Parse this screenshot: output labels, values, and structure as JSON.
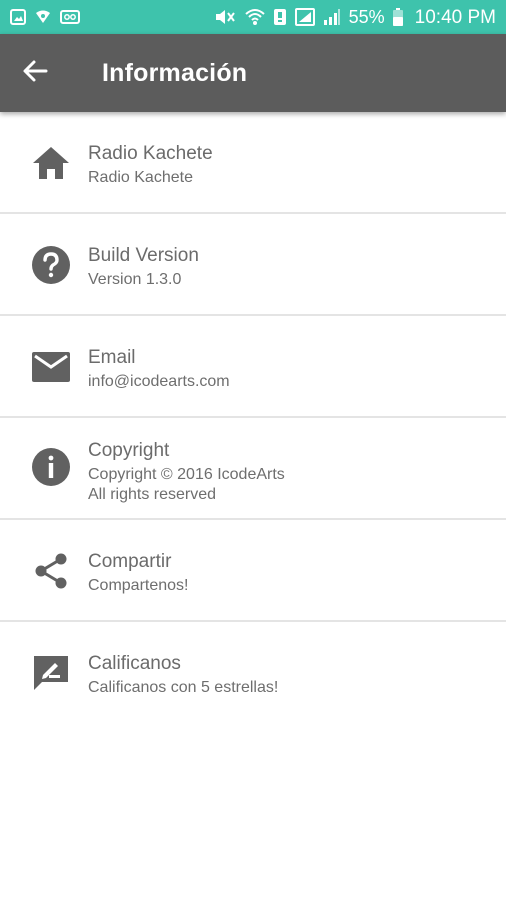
{
  "status_bar": {
    "battery": "55%",
    "time": "10:40 PM",
    "icons": [
      "gallery-icon",
      "hotspot-icon",
      "voicemail-icon",
      "mute-icon",
      "wifi-icon",
      "battery-saver-icon",
      "signal-icon",
      "battery-icon"
    ]
  },
  "app_bar": {
    "title": "Información",
    "background": "#5c5c5c",
    "accent": "#3ec3ac"
  },
  "items": [
    {
      "icon": "home-icon",
      "title": "Radio Kachete",
      "subtitle": "Radio Kachete"
    },
    {
      "icon": "help-circle-icon",
      "title": "Build Version",
      "subtitle": "Version 1.3.0"
    },
    {
      "icon": "email-icon",
      "title": "Email",
      "subtitle": "info@icodearts.com"
    },
    {
      "icon": "info-icon",
      "title": "Copyright",
      "subtitle": "Copyright © 2016 IcodeArts\n All rights reserved"
    },
    {
      "icon": "share-icon",
      "title": "Compartir",
      "subtitle": "Compartenos!"
    },
    {
      "icon": "rate-review-icon",
      "title": "Calificanos",
      "subtitle": "Calificanos con 5 estrellas!"
    }
  ]
}
